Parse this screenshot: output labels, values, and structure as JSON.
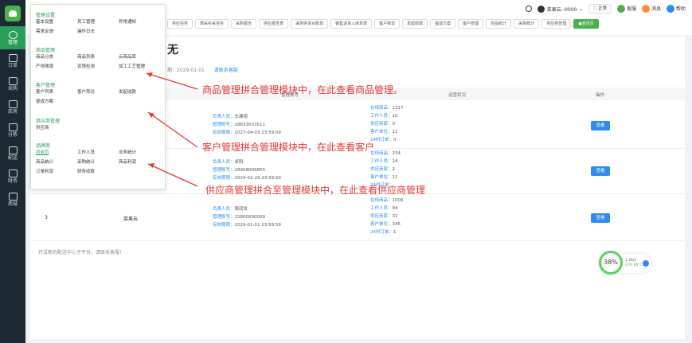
{
  "sidebar": {
    "items": [
      {
        "label": "管理",
        "icon": "gear-icon",
        "active": true
      },
      {
        "label": "订单",
        "icon": "document-icon"
      },
      {
        "label": "采购",
        "icon": "cart-icon"
      },
      {
        "label": "库房",
        "icon": "home-icon"
      },
      {
        "label": "分拣",
        "icon": "box-icon"
      },
      {
        "label": "配送",
        "icon": "truck-icon"
      },
      {
        "label": "财务",
        "icon": "database-icon"
      },
      {
        "label": "商城",
        "icon": "grid-icon"
      }
    ]
  },
  "topbar": {
    "tabs": [
      "供应任务",
      "预采补采任务",
      "采购报告",
      "供应报告表 ",
      "采购供货对账单",
      "销售退货入库单表",
      "客户拜访",
      "发起收款",
      "提成方案",
      "客户管理",
      "商品统计",
      "采购统计",
      "供应商管理",
      "●首页页"
    ],
    "user": "菜果云--0000",
    "mode": "正常",
    "service": "客服",
    "messages": "消息",
    "help": "帮助"
  },
  "main": {
    "title_fragment": "无",
    "expiry_prefix": "期：2029-01-01",
    "contact_link": "请联系客服",
    "headers": [
      "管理账号",
      "运营状况",
      "操作"
    ],
    "rows": [
      {
        "idx": "",
        "name": "",
        "contact": [
          "负责人员：",
          "车建周",
          "管理账号：",
          "18633033511",
          "有效期限：",
          "2027-04-03 23:59:59"
        ],
        "stats": [
          "在线商品：",
          "1317",
          "工作人员：",
          "10",
          "供应商家：",
          "0",
          "客户单位：",
          "11",
          "24时订单：",
          "0"
        ]
      },
      {
        "idx": "",
        "name": "",
        "contact": [
          "负责人员：",
          "卓阳",
          "管理账号：",
          "18908009855",
          "有效期限：",
          "2024-02-29 23:59:59"
        ],
        "stats": [
          "在线商品：",
          "234",
          "工作人员：",
          "14",
          "供应商家：",
          "2",
          "客户单位：",
          "11",
          "24时订单：",
          ""
        ]
      },
      {
        "idx": "3",
        "name": "菜果云",
        "contact": [
          "负责人员：",
          "周润发",
          "管理账号：",
          "15800000000",
          "有效期限：",
          "2029-01-01 23:59:59"
        ],
        "stats": [
          "在线商品：",
          "1006",
          "工作人员：",
          "94",
          "供应商家：",
          "31",
          "客户单位：",
          "345",
          "24时订单：",
          "1"
        ]
      }
    ],
    "view_label": "查看",
    "footer_note": "开设新的配送中心子平台，请联系客服！"
  },
  "monitor": {
    "percent": "38%",
    "speed": "1.2K/s",
    "cpu": "CPU 85°C"
  },
  "dropdown": {
    "groups": [
      {
        "title": "管理设置",
        "items": [
          "基本设置",
          "员工管理",
          "异常通知",
          "需求反馈",
          "操作日志"
        ]
      },
      {
        "title": "商品管理",
        "items": [
          "商品分类",
          "商品列表",
          "云商品库",
          "产地溯源",
          "农残检测",
          "加工工艺管理"
        ]
      },
      {
        "title": "客户管理",
        "items": [
          "客户列表",
          "客户拜访",
          "发起收款",
          "提成方案"
        ]
      },
      {
        "title": "供应商管理",
        "items": [
          "供应商"
        ]
      },
      {
        "title": "品牌商",
        "items": [
          "初启页",
          "工作人员",
          "业务统计",
          "商品统计",
          "采购统计",
          "商品利润",
          "订单利润",
          "财务收款"
        ]
      }
    ]
  },
  "annotations": {
    "product": "商品管理拼合管理模块中，在此查看商品管理。",
    "customer": "客户管理拼合管理模块中，在此查看客户",
    "supplier": "供应商管理拼合至管理模块中，在此查看供应商管理"
  },
  "colors": {
    "sidebar": "#1e2a33",
    "accent": "#2a9d5a",
    "link": "#2d8cf0",
    "annotation": "#e53935"
  }
}
